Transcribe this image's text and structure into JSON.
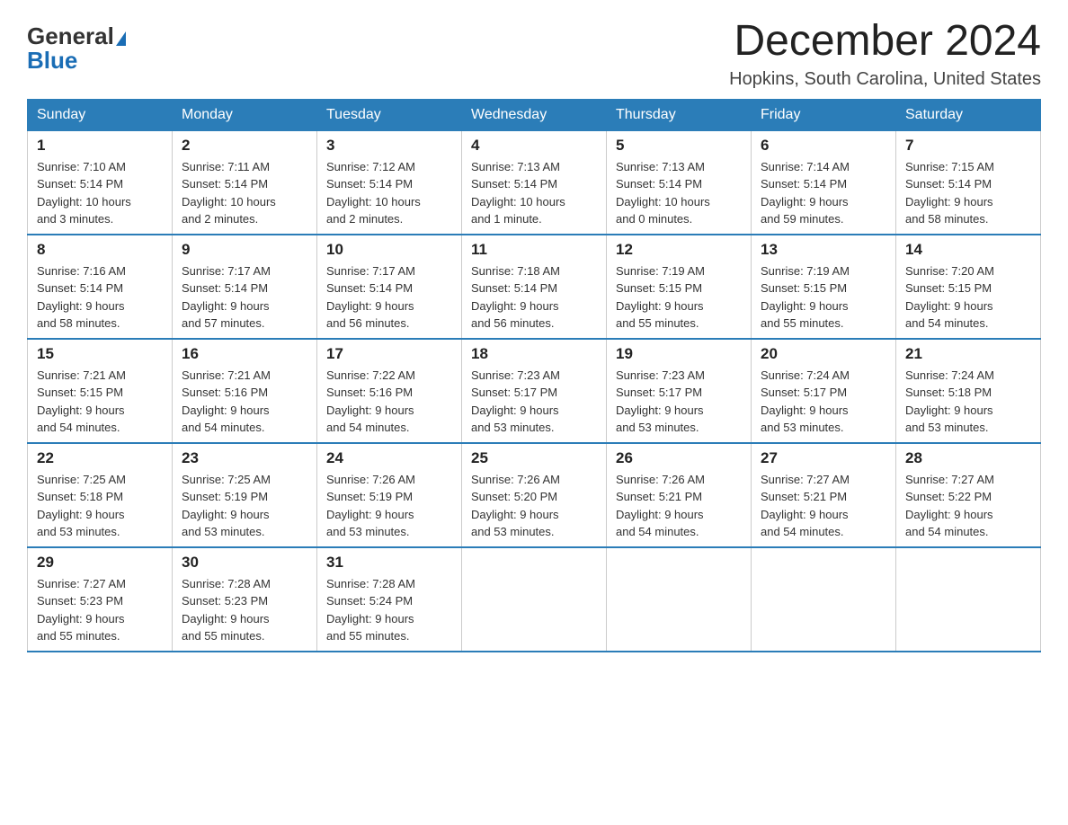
{
  "logo": {
    "general": "General",
    "blue": "Blue",
    "triangle": "▲"
  },
  "header": {
    "title": "December 2024",
    "location": "Hopkins, South Carolina, United States"
  },
  "days_of_week": [
    "Sunday",
    "Monday",
    "Tuesday",
    "Wednesday",
    "Thursday",
    "Friday",
    "Saturday"
  ],
  "weeks": [
    [
      {
        "day": "1",
        "sunrise": "7:10 AM",
        "sunset": "5:14 PM",
        "daylight": "10 hours and 3 minutes."
      },
      {
        "day": "2",
        "sunrise": "7:11 AM",
        "sunset": "5:14 PM",
        "daylight": "10 hours and 2 minutes."
      },
      {
        "day": "3",
        "sunrise": "7:12 AM",
        "sunset": "5:14 PM",
        "daylight": "10 hours and 2 minutes."
      },
      {
        "day": "4",
        "sunrise": "7:13 AM",
        "sunset": "5:14 PM",
        "daylight": "10 hours and 1 minute."
      },
      {
        "day": "5",
        "sunrise": "7:13 AM",
        "sunset": "5:14 PM",
        "daylight": "10 hours and 0 minutes."
      },
      {
        "day": "6",
        "sunrise": "7:14 AM",
        "sunset": "5:14 PM",
        "daylight": "9 hours and 59 minutes."
      },
      {
        "day": "7",
        "sunrise": "7:15 AM",
        "sunset": "5:14 PM",
        "daylight": "9 hours and 58 minutes."
      }
    ],
    [
      {
        "day": "8",
        "sunrise": "7:16 AM",
        "sunset": "5:14 PM",
        "daylight": "9 hours and 58 minutes."
      },
      {
        "day": "9",
        "sunrise": "7:17 AM",
        "sunset": "5:14 PM",
        "daylight": "9 hours and 57 minutes."
      },
      {
        "day": "10",
        "sunrise": "7:17 AM",
        "sunset": "5:14 PM",
        "daylight": "9 hours and 56 minutes."
      },
      {
        "day": "11",
        "sunrise": "7:18 AM",
        "sunset": "5:14 PM",
        "daylight": "9 hours and 56 minutes."
      },
      {
        "day": "12",
        "sunrise": "7:19 AM",
        "sunset": "5:15 PM",
        "daylight": "9 hours and 55 minutes."
      },
      {
        "day": "13",
        "sunrise": "7:19 AM",
        "sunset": "5:15 PM",
        "daylight": "9 hours and 55 minutes."
      },
      {
        "day": "14",
        "sunrise": "7:20 AM",
        "sunset": "5:15 PM",
        "daylight": "9 hours and 54 minutes."
      }
    ],
    [
      {
        "day": "15",
        "sunrise": "7:21 AM",
        "sunset": "5:15 PM",
        "daylight": "9 hours and 54 minutes."
      },
      {
        "day": "16",
        "sunrise": "7:21 AM",
        "sunset": "5:16 PM",
        "daylight": "9 hours and 54 minutes."
      },
      {
        "day": "17",
        "sunrise": "7:22 AM",
        "sunset": "5:16 PM",
        "daylight": "9 hours and 54 minutes."
      },
      {
        "day": "18",
        "sunrise": "7:23 AM",
        "sunset": "5:17 PM",
        "daylight": "9 hours and 53 minutes."
      },
      {
        "day": "19",
        "sunrise": "7:23 AM",
        "sunset": "5:17 PM",
        "daylight": "9 hours and 53 minutes."
      },
      {
        "day": "20",
        "sunrise": "7:24 AM",
        "sunset": "5:17 PM",
        "daylight": "9 hours and 53 minutes."
      },
      {
        "day": "21",
        "sunrise": "7:24 AM",
        "sunset": "5:18 PM",
        "daylight": "9 hours and 53 minutes."
      }
    ],
    [
      {
        "day": "22",
        "sunrise": "7:25 AM",
        "sunset": "5:18 PM",
        "daylight": "9 hours and 53 minutes."
      },
      {
        "day": "23",
        "sunrise": "7:25 AM",
        "sunset": "5:19 PM",
        "daylight": "9 hours and 53 minutes."
      },
      {
        "day": "24",
        "sunrise": "7:26 AM",
        "sunset": "5:19 PM",
        "daylight": "9 hours and 53 minutes."
      },
      {
        "day": "25",
        "sunrise": "7:26 AM",
        "sunset": "5:20 PM",
        "daylight": "9 hours and 53 minutes."
      },
      {
        "day": "26",
        "sunrise": "7:26 AM",
        "sunset": "5:21 PM",
        "daylight": "9 hours and 54 minutes."
      },
      {
        "day": "27",
        "sunrise": "7:27 AM",
        "sunset": "5:21 PM",
        "daylight": "9 hours and 54 minutes."
      },
      {
        "day": "28",
        "sunrise": "7:27 AM",
        "sunset": "5:22 PM",
        "daylight": "9 hours and 54 minutes."
      }
    ],
    [
      {
        "day": "29",
        "sunrise": "7:27 AM",
        "sunset": "5:23 PM",
        "daylight": "9 hours and 55 minutes."
      },
      {
        "day": "30",
        "sunrise": "7:28 AM",
        "sunset": "5:23 PM",
        "daylight": "9 hours and 55 minutes."
      },
      {
        "day": "31",
        "sunrise": "7:28 AM",
        "sunset": "5:24 PM",
        "daylight": "9 hours and 55 minutes."
      },
      null,
      null,
      null,
      null
    ]
  ],
  "labels": {
    "sunrise": "Sunrise:",
    "sunset": "Sunset:",
    "daylight": "Daylight:"
  }
}
